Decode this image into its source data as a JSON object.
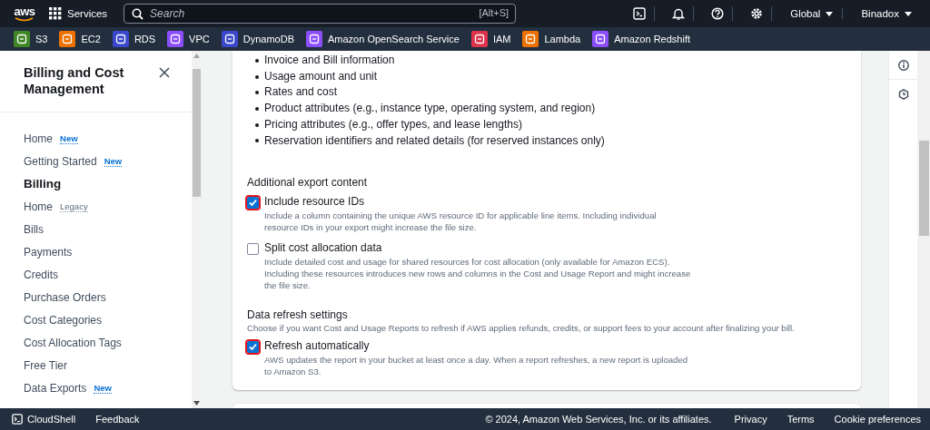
{
  "top_nav": {
    "logo": "aws",
    "services_label": "Services",
    "search": {
      "placeholder": "Search",
      "shortcut": "[Alt+S]"
    },
    "region": "Global",
    "account": "Binadox"
  },
  "favorites": [
    {
      "label": "S3",
      "color": "#3f8624"
    },
    {
      "label": "EC2",
      "color": "#ed7100"
    },
    {
      "label": "RDS",
      "color": "#3b48cc"
    },
    {
      "label": "VPC",
      "color": "#8c4fff"
    },
    {
      "label": "DynamoDB",
      "color": "#3b48cc"
    },
    {
      "label": "Amazon OpenSearch Service",
      "color": "#8c4fff"
    },
    {
      "label": "IAM",
      "color": "#dd344c"
    },
    {
      "label": "Lambda",
      "color": "#ed7100"
    },
    {
      "label": "Amazon Redshift",
      "color": "#8c4fff"
    }
  ],
  "sidebar": {
    "title": "Billing and Cost Management",
    "items": [
      {
        "kind": "link",
        "label": "Home",
        "badge": "New"
      },
      {
        "kind": "link",
        "label": "Getting Started",
        "badge": "New"
      },
      {
        "kind": "heading",
        "label": "Billing"
      },
      {
        "kind": "link",
        "label": "Home",
        "badge": "Legacy"
      },
      {
        "kind": "link",
        "label": "Bills"
      },
      {
        "kind": "link",
        "label": "Payments"
      },
      {
        "kind": "link",
        "label": "Credits"
      },
      {
        "kind": "link",
        "label": "Purchase Orders"
      },
      {
        "kind": "link",
        "label": "Cost Categories"
      },
      {
        "kind": "link",
        "label": "Cost Allocation Tags"
      },
      {
        "kind": "link",
        "label": "Free Tier"
      },
      {
        "kind": "link",
        "label": "Data Exports",
        "badge": "New"
      }
    ]
  },
  "content": {
    "bullets": [
      "Invoice and Bill information",
      "Usage amount and unit",
      "Rates and cost",
      "Product attributes (e.g., instance type, operating system, and region)",
      "Pricing attributes (e.g., offer types, and lease lengths)",
      "Reservation identifiers and related details (for reserved instances only)"
    ],
    "sections": [
      {
        "title": "Additional export content",
        "options": [
          {
            "label": "Include resource IDs",
            "description": "Include a column containing the unique AWS resource ID for applicable line items. Including individual resource IDs in your export might increase the file size.",
            "checked": true,
            "highlighted": true
          },
          {
            "label": "Split cost allocation data",
            "description": "Include detailed cost and usage for shared resources for cost allocation (only available for Amazon ECS). Including these resources introduces new rows and columns in the Cost and Usage Report and might increase the file size.",
            "checked": false,
            "highlighted": false
          }
        ]
      },
      {
        "title": "Data refresh settings",
        "description": "Choose if you want Cost and Usage Reports to refresh if AWS applies refunds, credits, or support fees to your account after finalizing your bill.",
        "options": [
          {
            "label": "Refresh automatically",
            "description": "AWS updates the report in your bucket at least once a day. When a report refreshes, a new report is uploaded to Amazon S3.",
            "checked": true,
            "highlighted": true
          }
        ]
      }
    ]
  },
  "footer": {
    "cloudshell": "CloudShell",
    "feedback": "Feedback",
    "copyright": "© 2024, Amazon Web Services, Inc. or its affiliates.",
    "links": [
      "Privacy",
      "Terms",
      "Cookie preferences"
    ]
  }
}
